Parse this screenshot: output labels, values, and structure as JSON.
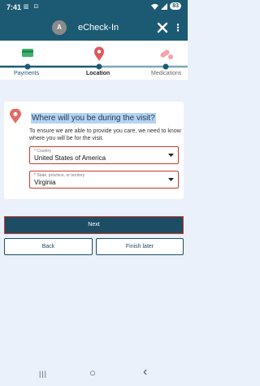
{
  "status_bar": {
    "time": "7:41",
    "left_icons": "▥ ⊡",
    "battery": "83",
    "wifi_icon": "wifi-icon",
    "signal_icon": "signal-icon"
  },
  "app_bar": {
    "avatar_initial": "A",
    "title": "eCheck-In",
    "more_symbol": "⋮"
  },
  "steps": [
    {
      "label": "Payments",
      "state": "done"
    },
    {
      "label": "Location",
      "state": "current"
    },
    {
      "label": "Medications",
      "state": "todo"
    }
  ],
  "location_card": {
    "question": "Where will you be during the visit?",
    "info": "To ensure we are able to provide you care, we need to know where you will be for the visit.",
    "country": {
      "label": "Country",
      "required_mark": "*",
      "value": "United States of America"
    },
    "state": {
      "label": "State, province, or territory",
      "required_mark": "*",
      "value": "Virginia"
    }
  },
  "actions": {
    "next": "Next",
    "back": "Back",
    "finish_later": "Finish later"
  },
  "nav_bar": {
    "recents": "|||",
    "home": "○",
    "back": "‹"
  },
  "colors": {
    "header": "#1c5a73",
    "accent_red": "#cc3a2a",
    "highlight": "#b7d3f2",
    "background": "#eaf1fa"
  }
}
